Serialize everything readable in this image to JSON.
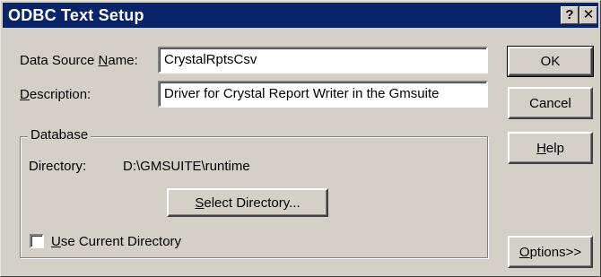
{
  "window": {
    "title": "ODBC Text Setup"
  },
  "titlebar": {
    "help_glyph": "?",
    "close_glyph": "✕"
  },
  "fields": {
    "dsn": {
      "label_prefix": "Data Source ",
      "label_accel": "N",
      "label_suffix": "ame:",
      "value": "CrystalRptsCsv"
    },
    "description": {
      "label_accel": "D",
      "label_suffix": "escription:",
      "value": "Driver for Crystal Report Writer in the Gmsuite"
    }
  },
  "database": {
    "group_label": "Database",
    "directory_label": "Directory:",
    "directory_value": "D:\\GMSUITE\\runtime",
    "select_button": {
      "accel": "S",
      "rest": "elect Directory..."
    },
    "use_current": {
      "accel": "U",
      "rest": "se Current Directory",
      "checked": false
    }
  },
  "buttons": {
    "ok": "OK",
    "cancel": "Cancel",
    "help": {
      "accel": "H",
      "rest": "elp"
    },
    "options": {
      "accel": "O",
      "rest": "ptions>>"
    }
  }
}
